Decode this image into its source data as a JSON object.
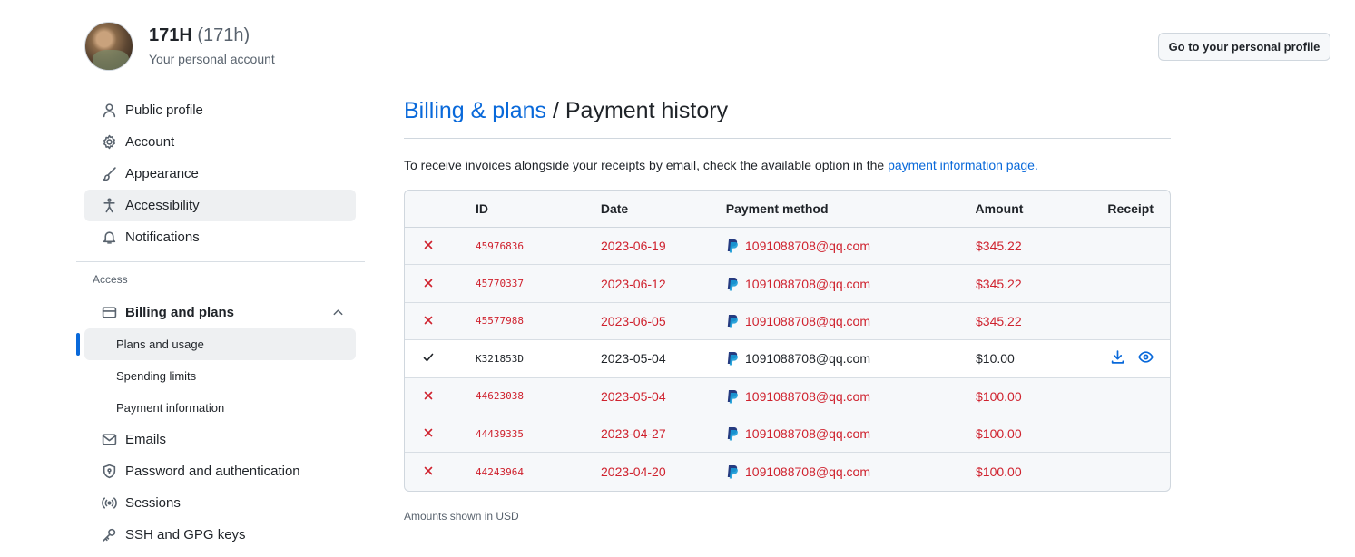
{
  "user": {
    "display_name": "171H",
    "login": "(171h)",
    "subtitle": "Your personal account"
  },
  "header": {
    "profile_button": "Go to your personal profile"
  },
  "sidebar": {
    "items": [
      {
        "label": "Public profile",
        "icon": "person-icon"
      },
      {
        "label": "Account",
        "icon": "gear-icon"
      },
      {
        "label": "Appearance",
        "icon": "paintbrush-icon"
      },
      {
        "label": "Accessibility",
        "icon": "accessibility-icon"
      },
      {
        "label": "Notifications",
        "icon": "bell-icon"
      }
    ],
    "section_access": "Access",
    "billing": {
      "label": "Billing and plans",
      "icon": "credit-card-icon",
      "subitems": [
        "Plans and usage",
        "Spending limits",
        "Payment information"
      ]
    },
    "items2": [
      {
        "label": "Emails",
        "icon": "mail-icon"
      },
      {
        "label": "Password and authentication",
        "icon": "shield-lock-icon"
      },
      {
        "label": "Sessions",
        "icon": "broadcast-icon"
      },
      {
        "label": "SSH and GPG keys",
        "icon": "key-icon"
      }
    ]
  },
  "main": {
    "breadcrumb_link": "Billing & plans",
    "breadcrumb_sep": " / ",
    "page_title": "Payment history",
    "info_text": "To receive invoices alongside your receipts by email, check the available option in the ",
    "info_link": "payment information page.",
    "footer_note": "Amounts shown in USD"
  },
  "table": {
    "headers": {
      "id": "ID",
      "date": "Date",
      "method": "Payment method",
      "amount": "Amount",
      "receipt": "Receipt"
    },
    "rows": [
      {
        "status": "failed",
        "id": "45976836",
        "date": "2023-06-19",
        "method": "1091088708@qq.com",
        "amount": "$345.22"
      },
      {
        "status": "failed",
        "id": "45770337",
        "date": "2023-06-12",
        "method": "1091088708@qq.com",
        "amount": "$345.22"
      },
      {
        "status": "failed",
        "id": "45577988",
        "date": "2023-06-05",
        "method": "1091088708@qq.com",
        "amount": "$345.22"
      },
      {
        "status": "success",
        "id": "K321853D",
        "date": "2023-05-04",
        "method": "1091088708@qq.com",
        "amount": "$10.00"
      },
      {
        "status": "failed",
        "id": "44623038",
        "date": "2023-05-04",
        "method": "1091088708@qq.com",
        "amount": "$100.00"
      },
      {
        "status": "failed",
        "id": "44439335",
        "date": "2023-04-27",
        "method": "1091088708@qq.com",
        "amount": "$100.00"
      },
      {
        "status": "failed",
        "id": "44243964",
        "date": "2023-04-20",
        "method": "1091088708@qq.com",
        "amount": "$100.00"
      }
    ]
  },
  "colors": {
    "link": "#0969da",
    "failed": "#cf222e",
    "paypal_dark": "#253b80",
    "paypal_light": "#179bd7"
  }
}
